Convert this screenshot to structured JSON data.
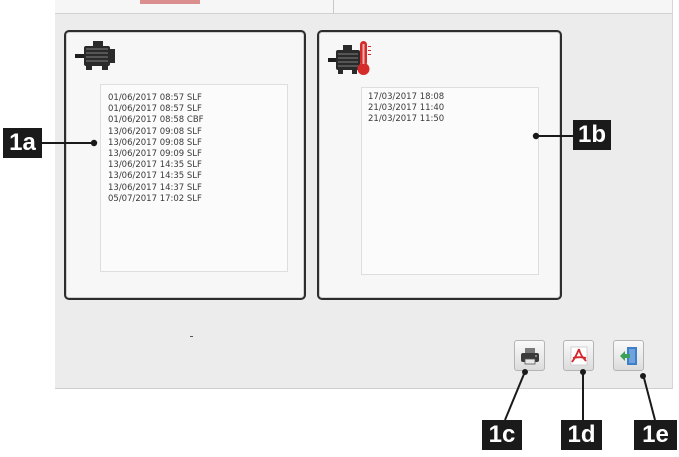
{
  "panel_motor": {
    "icon": "motor-icon",
    "entries": [
      "01/06/2017 08:57 SLF",
      "01/06/2017 08:57 SLF",
      "01/06/2017 08:58 CBF",
      "13/06/2017 09:08 SLF",
      "13/06/2017 09:08 SLF",
      "13/06/2017 09:09 SLF",
      "13/06/2017 14:35 SLF",
      "13/06/2017 14:35 SLF",
      "13/06/2017 14:37 SLF",
      "05/07/2017 17:02 SLF"
    ]
  },
  "panel_temperature": {
    "icon": "motor-thermometer-icon",
    "entries": [
      "17/03/2017 18:08",
      "21/03/2017 11:40",
      "21/03/2017 11:50"
    ]
  },
  "toolbar": {
    "print_icon": "printer-icon",
    "pdf_icon": "pdf-icon",
    "exit_icon": "exit-door-icon"
  },
  "callouts": {
    "motor_list": "1a",
    "temperature_list": "1b",
    "print": "1c",
    "pdf": "1d",
    "exit": "1e"
  },
  "colors": {
    "panel_border": "#2d2d2d",
    "callout_bg": "#1a1a1a",
    "thermometer_red": "#d62b2b",
    "pdf_red": "#d7262c",
    "exit_green": "#3aa05a",
    "exit_blue": "#3f7fc8"
  }
}
